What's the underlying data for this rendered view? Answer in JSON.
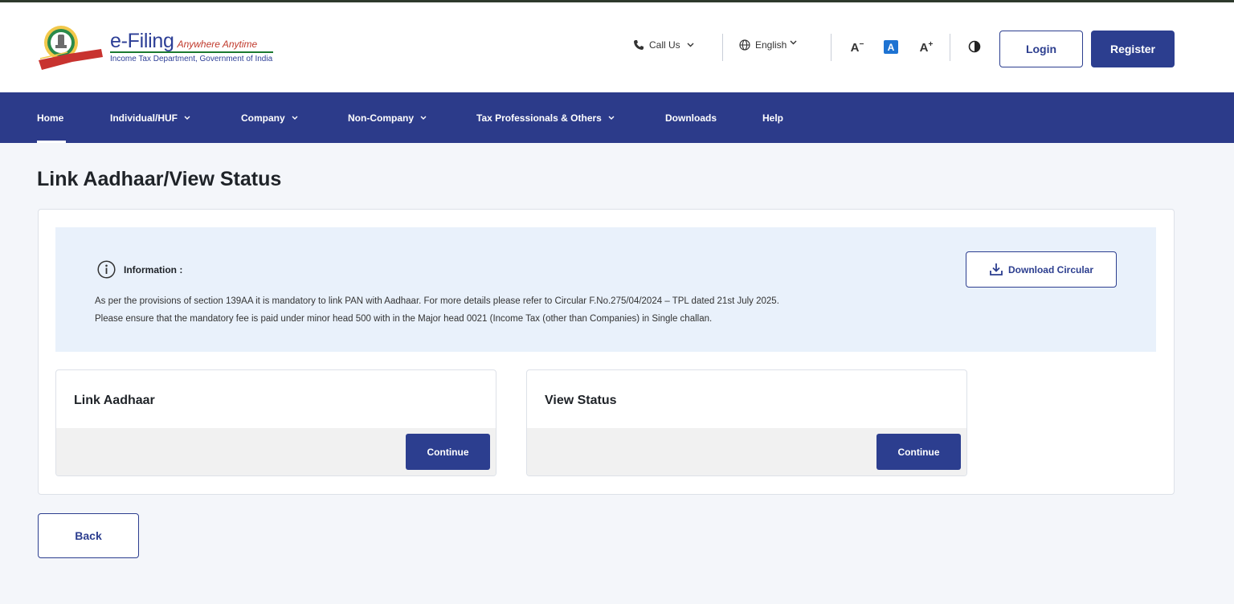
{
  "header": {
    "logo_main": "e-Filing",
    "logo_tagline": "Anywhere Anytime",
    "logo_sub": "Income Tax Department, Government of India",
    "call_us": "Call Us",
    "language": "English",
    "font_decrease": "A",
    "font_default": "A",
    "font_increase": "A",
    "login": "Login",
    "register": "Register"
  },
  "nav": {
    "items": [
      {
        "label": "Home",
        "active": true
      },
      {
        "label": "Individual/HUF",
        "dropdown": true
      },
      {
        "label": "Company",
        "dropdown": true
      },
      {
        "label": "Non-Company",
        "dropdown": true
      },
      {
        "label": "Tax Professionals & Others",
        "dropdown": true
      },
      {
        "label": "Downloads"
      },
      {
        "label": "Help"
      }
    ]
  },
  "page": {
    "title": "Link Aadhaar/View Status",
    "info": {
      "heading": "Information :",
      "line1": "As per the provisions of section 139AA it is mandatory to link PAN with Aadhaar. For more details please refer to Circular F.No.275/04/2024 – TPL dated 21st July 2025.",
      "line2": "Please ensure that the mandatory fee is paid under minor head 500 with in the Major head 0021 (Income Tax (other than Companies) in Single challan.",
      "download_label": "Download Circular"
    },
    "tiles": [
      {
        "title": "Link Aadhaar",
        "button": "Continue"
      },
      {
        "title": "View Status",
        "button": "Continue"
      }
    ],
    "back_label": "Back"
  },
  "colors": {
    "brand_blue": "#2c3e8f",
    "nav_bg": "#2c3b8a",
    "info_bg": "#e9f1fb"
  }
}
